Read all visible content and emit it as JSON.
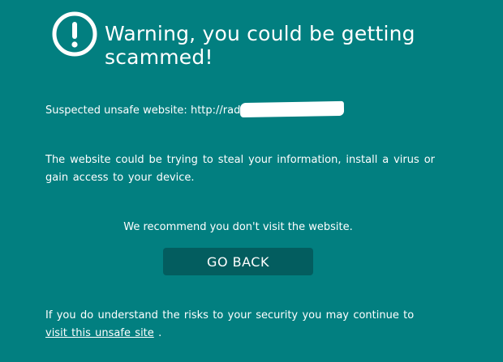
{
  "header": {
    "icon": "exclamation-circle-icon",
    "title": "Warning, you could be getting scammed!"
  },
  "suspect": {
    "label": "Suspected unsafe website:",
    "url_visible": "http://rad",
    "url_redacted": true
  },
  "description": "The website could be trying to steal your information, install a virus or gain access to your device.",
  "recommendation": "We recommend you don't visit the website.",
  "go_back_button": "GO BACK",
  "continue": {
    "prefix": "If you do understand the risks to your security you may continue to",
    "link_text": "visit this unsafe site",
    "suffix": "."
  },
  "colors": {
    "background": "#027f80",
    "button": "#035d5f",
    "text": "#ffffff"
  }
}
